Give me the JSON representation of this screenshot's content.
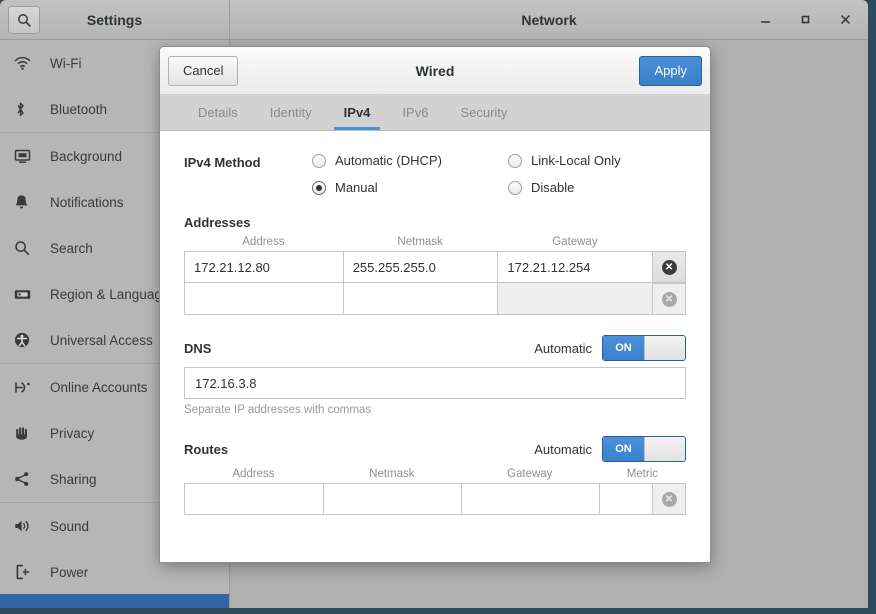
{
  "window": {
    "settings_title": "Settings",
    "network_title": "Network",
    "search_icon": "search-icon",
    "controls": {
      "minimize": "–",
      "maximize": "□",
      "close": "✕"
    }
  },
  "sidebar": {
    "items": [
      {
        "label": "Wi-Fi",
        "icon": "wifi-icon"
      },
      {
        "label": "Bluetooth",
        "icon": "bluetooth-icon"
      },
      {
        "label": "Background",
        "icon": "monitor-icon"
      },
      {
        "label": "Notifications",
        "icon": "bell-icon"
      },
      {
        "label": "Search",
        "icon": "magnifier-icon"
      },
      {
        "label": "Region & Language",
        "icon": "keyboard-icon"
      },
      {
        "label": "Universal Access",
        "icon": "accessibility-icon"
      },
      {
        "label": "Online Accounts",
        "icon": "online-accounts-icon"
      },
      {
        "label": "Privacy",
        "icon": "hand-icon"
      },
      {
        "label": "Sharing",
        "icon": "share-icon"
      },
      {
        "label": "Sound",
        "icon": "speaker-icon"
      },
      {
        "label": "Power",
        "icon": "power-icon"
      }
    ]
  },
  "background_panel": {
    "add_buttons": [
      "+",
      "+"
    ],
    "gear_icons": [
      "gear-icon",
      "gear-icon"
    ]
  },
  "dialog": {
    "cancel_label": "Cancel",
    "title": "Wired",
    "apply_label": "Apply",
    "tabs": [
      {
        "label": "Details",
        "active": false
      },
      {
        "label": "Identity",
        "active": false
      },
      {
        "label": "IPv4",
        "active": true
      },
      {
        "label": "IPv6",
        "active": false
      },
      {
        "label": "Security",
        "active": false
      }
    ],
    "ipv4_method": {
      "label": "IPv4 Method",
      "options": [
        {
          "label": "Automatic (DHCP)",
          "selected": false
        },
        {
          "label": "Link-Local Only",
          "selected": false
        },
        {
          "label": "Manual",
          "selected": true
        },
        {
          "label": "Disable",
          "selected": false
        }
      ]
    },
    "addresses": {
      "title": "Addresses",
      "columns": [
        "Address",
        "Netmask",
        "Gateway"
      ],
      "rows": [
        {
          "address": "172.21.12.80",
          "netmask": "255.255.255.0",
          "gateway": "172.21.12.254",
          "gateway_disabled": false,
          "delete_enabled": true
        },
        {
          "address": "",
          "netmask": "",
          "gateway": "",
          "gateway_disabled": true,
          "delete_enabled": false
        }
      ]
    },
    "dns": {
      "title": "DNS",
      "automatic_label": "Automatic",
      "toggle_state": "ON",
      "value": "172.16.3.8",
      "hint": "Separate IP addresses with commas"
    },
    "routes": {
      "title": "Routes",
      "automatic_label": "Automatic",
      "toggle_state": "ON",
      "columns": [
        "Address",
        "Netmask",
        "Gateway",
        "Metric"
      ],
      "rows": [
        {
          "address": "",
          "netmask": "",
          "gateway": "",
          "metric": "",
          "delete_enabled": false
        }
      ]
    }
  },
  "colors": {
    "accent_blue": "#4a90d9",
    "apply_blue": "#3a7fc8",
    "selection_bar": "#3465a4",
    "chrome_gray": "#b6b6b6",
    "desktop": "#2e4a5c"
  }
}
